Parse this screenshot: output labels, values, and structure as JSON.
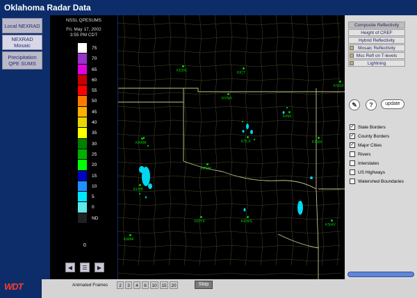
{
  "app_title": "Oklahoma Radar Data",
  "tabs": [
    {
      "label": "Local NEXRAD"
    },
    {
      "label": "NEXRAD Mosaic"
    },
    {
      "label": "Precipitation QPE SUMS"
    }
  ],
  "legend": {
    "source": "NSSL QPESUMS",
    "date": "Fri, May 17, 2002",
    "time": "3:55 PM CDT",
    "bottom_value": "0",
    "scale": [
      {
        "label": "75",
        "color": "#ffffff"
      },
      {
        "label": "70",
        "color": "#9933cc"
      },
      {
        "label": "65",
        "color": "#e000e0"
      },
      {
        "label": "60",
        "color": "#c80000"
      },
      {
        "label": "55",
        "color": "#ff0000"
      },
      {
        "label": "50",
        "color": "#ff7a00"
      },
      {
        "label": "45",
        "color": "#ffb000"
      },
      {
        "label": "40",
        "color": "#e8d800"
      },
      {
        "label": "35",
        "color": "#ffff00"
      },
      {
        "label": "30",
        "color": "#008000"
      },
      {
        "label": "25",
        "color": "#00b000"
      },
      {
        "label": "20",
        "color": "#00ff00"
      },
      {
        "label": "15",
        "color": "#0000c0"
      },
      {
        "label": "10",
        "color": "#1e90ff"
      },
      {
        "label": "5",
        "color": "#00e5ff"
      },
      {
        "label": "0",
        "color": "#5fe8e8"
      },
      {
        "label": "ND",
        "color": "#202020"
      }
    ]
  },
  "map": {
    "cities": [
      "KDDC",
      "KICT",
      "KVNX",
      "KINX",
      "KSGF",
      "KAMA",
      "KTLX",
      "KSRX",
      "KFDR",
      "KLBB",
      "KDYX",
      "KFWS",
      "KSHV",
      "KMAF"
    ]
  },
  "products": [
    {
      "label": "Composite Reflectivity",
      "selected": true,
      "arrow": false
    },
    {
      "label": "Height of CREF",
      "selected": false,
      "arrow": false
    },
    {
      "label": "Hybrid Reflectivity",
      "selected": false,
      "arrow": false
    },
    {
      "label": "Mosaic Reflectivity",
      "selected": false,
      "arrow": true
    },
    {
      "label": "Msc Refl on T-levels",
      "selected": false,
      "arrow": true
    },
    {
      "label": "Lightning",
      "selected": false,
      "arrow": true
    }
  ],
  "buttons": {
    "help": "?",
    "update": "update"
  },
  "overlays": [
    {
      "label": "State Borders",
      "checked": true
    },
    {
      "label": "County Borders",
      "checked": true
    },
    {
      "label": "Major Cities",
      "checked": true
    },
    {
      "label": "Rivers",
      "checked": false
    },
    {
      "label": "Interstates",
      "checked": false
    },
    {
      "label": "US Highways",
      "checked": false
    },
    {
      "label": "Watershed Boundaries",
      "checked": false
    }
  ],
  "logo": "WDT",
  "animation": {
    "label": "Animated Frames",
    "frames": [
      "2",
      "3",
      "4",
      "6",
      "10",
      "15",
      "20"
    ],
    "stop_label": "Stop"
  }
}
